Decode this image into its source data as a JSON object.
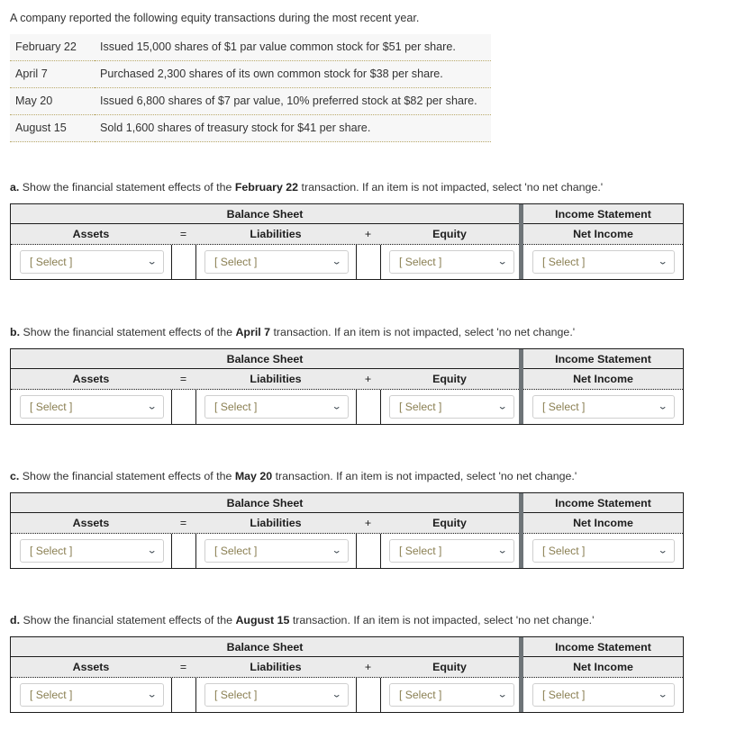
{
  "intro": "A company reported the following equity transactions during the most recent year.",
  "transactions": [
    {
      "date": "February 22",
      "description": "Issued 15,000 shares of $1 par value common stock for $51 per share."
    },
    {
      "date": "April 7",
      "description": "Purchased 2,300 shares of its own common stock for $38 per share."
    },
    {
      "date": "May 20",
      "description": "Issued 6,800 shares of $7 par value, 10% preferred stock at $82 per share."
    },
    {
      "date": "August 15",
      "description": "Sold 1,600 shares of treasury stock for $41 per share."
    }
  ],
  "headers": {
    "balance_sheet": "Balance Sheet",
    "income_statement": "Income Statement",
    "assets": "Assets",
    "equals": "=",
    "liabilities": "Liabilities",
    "plus": "+",
    "equity": "Equity",
    "net_income": "Net Income"
  },
  "select_placeholder": "[ Select ]",
  "chevron": "⌄",
  "sections": [
    {
      "letter": "a.",
      "prefix": " Show the financial statement effects of the ",
      "transaction": "February 22",
      "suffix": " transaction. If an item is not impacted, select 'no net change.'"
    },
    {
      "letter": "b.",
      "prefix": " Show the financial statement effects of the ",
      "transaction": "April 7",
      "suffix": " transaction. If an item is not impacted, select 'no net change.'"
    },
    {
      "letter": "c.",
      "prefix": " Show the financial statement effects of the ",
      "transaction": "May 20",
      "suffix": " transaction. If an item is not impacted, select 'no net change.'"
    },
    {
      "letter": "d.",
      "prefix": " Show the financial statement effects of the ",
      "transaction": "August 15",
      "suffix": " transaction. If an item is not impacted, select 'no net change.'"
    }
  ],
  "colors": {
    "header_bg": "#ebebeb",
    "divider": "#6e7478",
    "placeholder_text": "#8a7f52",
    "row_separator": "#b9a96a",
    "table_bg": "#f7f7f7"
  }
}
